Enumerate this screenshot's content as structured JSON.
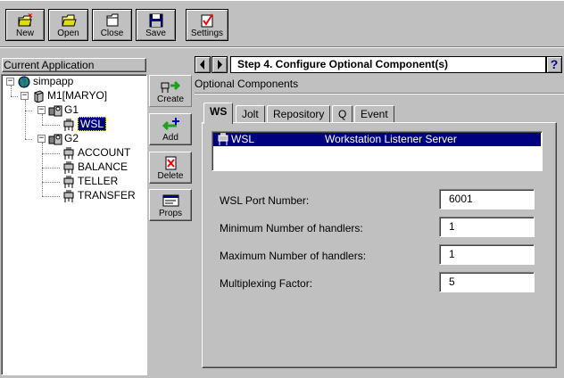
{
  "toolbar": {
    "new_label": "New",
    "open_label": "Open",
    "close_label": "Close",
    "save_label": "Save",
    "settings_label": "Settings"
  },
  "left_panel": {
    "title": "Current Application",
    "tree": {
      "root": "simpapp",
      "machine": "M1[MARYO]",
      "group1": "G1",
      "group1_child": "WSL",
      "group2": "G2",
      "group2_children": [
        "ACCOUNT",
        "BALANCE",
        "TELLER",
        "TRANSFER"
      ]
    }
  },
  "actions": {
    "create_label": "Create",
    "add_label": "Add",
    "delete_label": "Delete",
    "props_label": "Props"
  },
  "step": {
    "title": "Step 4. Configure Optional Component(s)",
    "help_label": "?"
  },
  "section": {
    "title": "Optional Components"
  },
  "tabs": [
    {
      "label": "WS",
      "active": true
    },
    {
      "label": "Jolt"
    },
    {
      "label": "Repository"
    },
    {
      "label": "Q"
    },
    {
      "label": "Event"
    }
  ],
  "components_list": [
    {
      "name": "WSL",
      "description": "Workstation Listener Server",
      "selected": true
    }
  ],
  "form": {
    "port_label": "WSL Port Number:",
    "port_value": "6001",
    "min_label": "Minimum Number of handlers:",
    "min_value": "1",
    "max_label": "Maximum Number of handlers:",
    "max_value": "1",
    "mux_label": "Multiplexing Factor:",
    "mux_value": "5"
  },
  "colors": {
    "face": "#c0c0c0",
    "selection": "#000080",
    "window": "#ffffff"
  },
  "icons": {
    "new": "new-folder-icon",
    "open": "open-folder-icon",
    "close": "close-folder-icon",
    "save": "floppy-disk-icon",
    "settings": "checklist-icon"
  }
}
